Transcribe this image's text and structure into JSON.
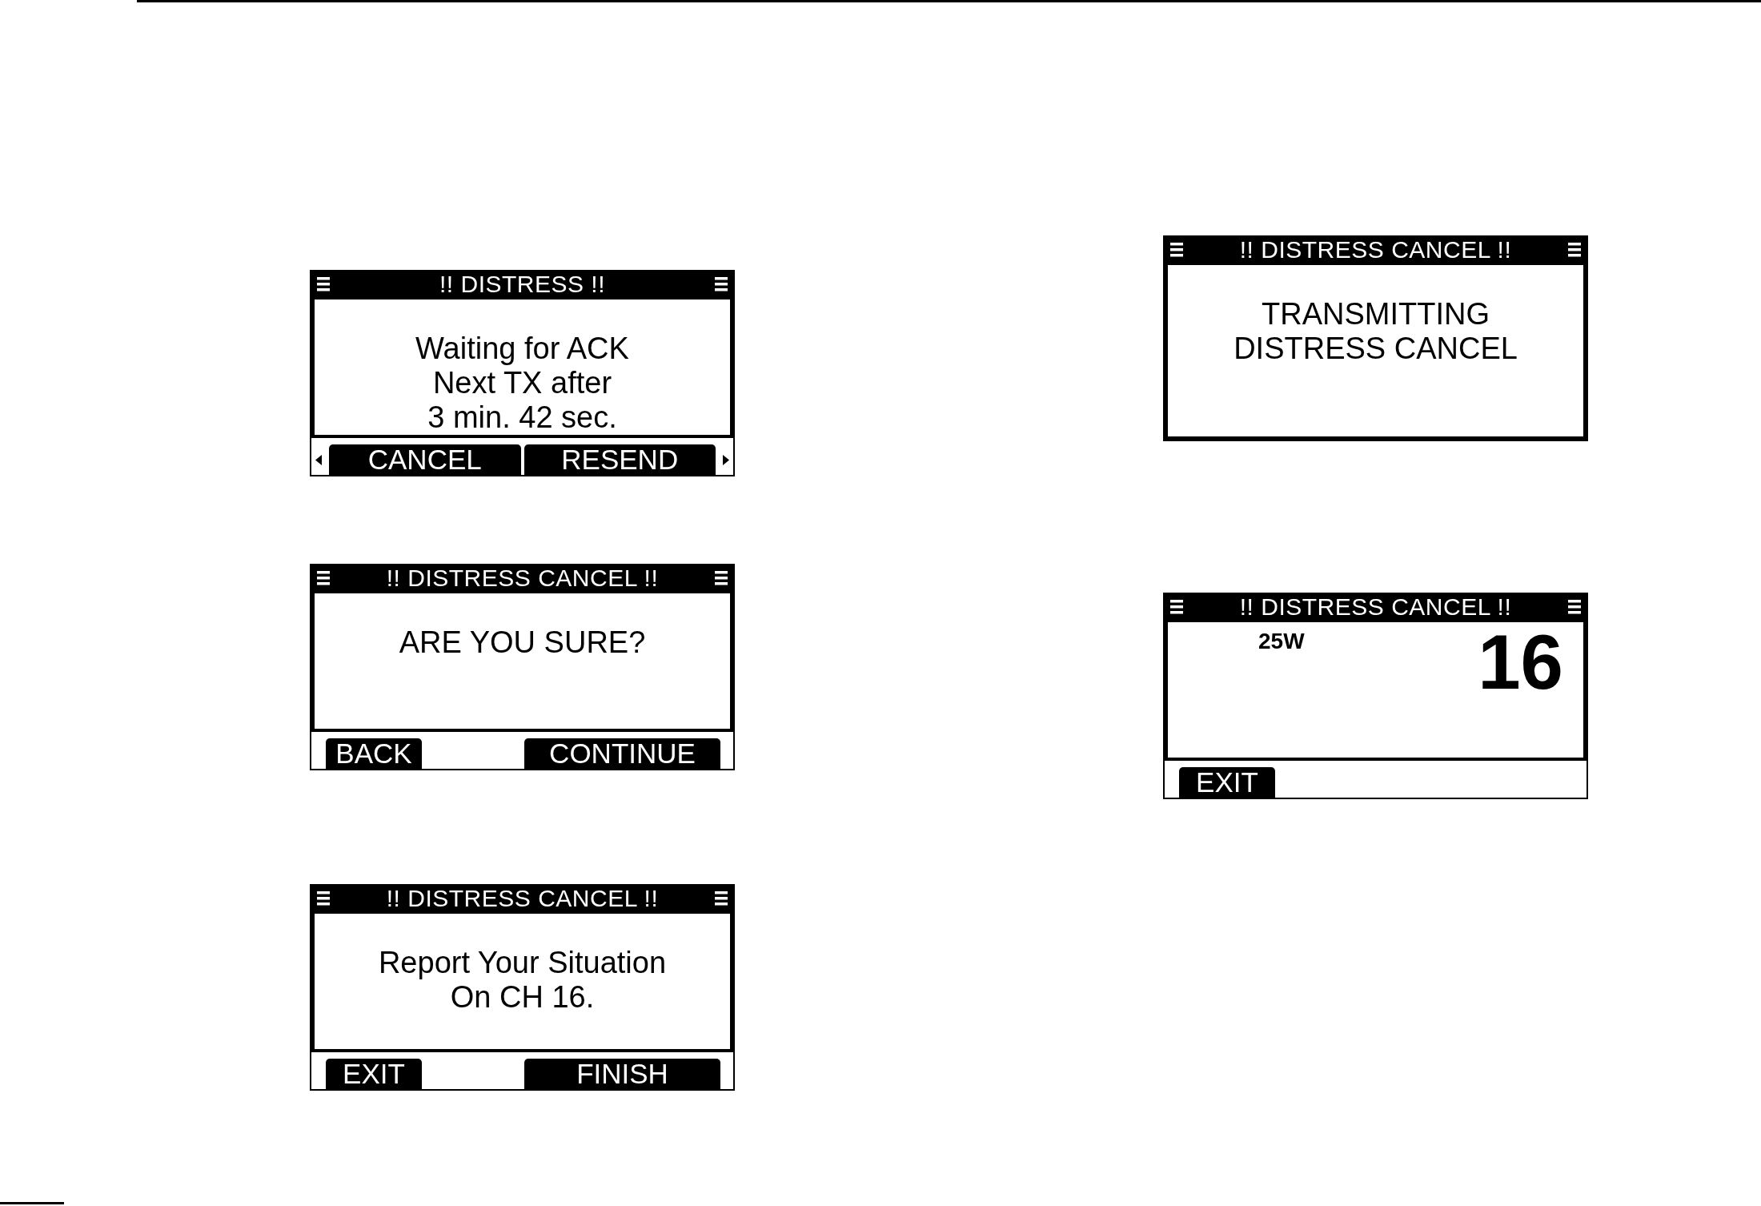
{
  "columns": [
    {
      "screens": [
        {
          "kind": "message",
          "title": "!! DISTRESS !!",
          "lines": [
            "Waiting for ACK",
            "Next TX after",
            "3 min. 42 sec."
          ],
          "scroll_arrows": true,
          "softkeys": [
            "CANCEL",
            "RESEND"
          ]
        },
        {
          "kind": "message",
          "title": "!! DISTRESS CANCEL !!",
          "lines": [
            "ARE YOU SURE?"
          ],
          "softkeys": [
            "BACK",
            "CONTINUE"
          ]
        },
        {
          "kind": "message",
          "title": "!! DISTRESS CANCEL !!",
          "lines": [
            "Report Your Situation",
            "On CH 16."
          ],
          "softkeys": [
            "EXIT",
            "FINISH"
          ]
        }
      ]
    },
    {
      "screens": [
        {
          "kind": "message",
          "title": "!! DISTRESS CANCEL !!",
          "lines": [
            "TRANSMITTING",
            "DISTRESS CANCEL"
          ]
        },
        {
          "kind": "channel",
          "title": "!! DISTRESS CANCEL !!",
          "power": "25W",
          "channel": "16",
          "softkeys": [
            "EXIT"
          ]
        }
      ]
    }
  ]
}
